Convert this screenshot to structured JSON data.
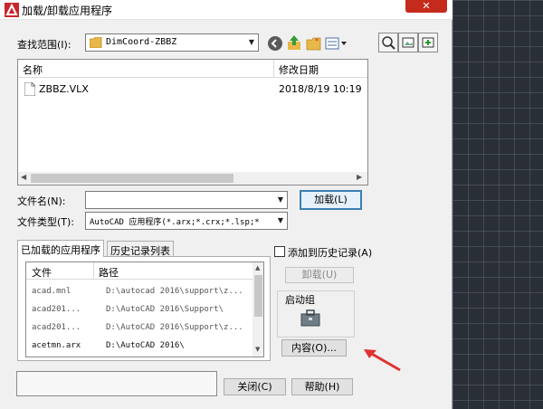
{
  "window": {
    "title": "加载/卸载应用程序",
    "close_label": "✕"
  },
  "lookin": {
    "label": "查找范围(I):",
    "value": "DimCoord-ZBBZ"
  },
  "filelist": {
    "columns": [
      "名称",
      "修改日期"
    ],
    "rows": [
      {
        "name": "ZBBZ.VLX",
        "date": "2018/8/19 10:19"
      }
    ]
  },
  "filename": {
    "label": "文件名(N):",
    "value": ""
  },
  "filetype": {
    "label": "文件类型(T):",
    "value": "AutoCAD 应用程序(*.arx;*.crx;*.lsp;*"
  },
  "buttons": {
    "load": "加载(L)",
    "unload": "卸载(U)",
    "contents": "内容(O)...",
    "close": "关闭(C)",
    "help": "帮助(H)"
  },
  "add_history": {
    "label": "添加到历史记录(A)",
    "checked": false
  },
  "tabs": [
    "已加载的应用程序",
    "历史记录列表"
  ],
  "loaded": {
    "columns": [
      "文件",
      "路径"
    ],
    "rows": [
      {
        "file": "acad.mnl",
        "path": "D:\\autocad 2016\\support\\z..."
      },
      {
        "file": "acad201...",
        "path": "D:\\AutoCAD 2016\\Support\\"
      },
      {
        "file": "acad201...",
        "path": "D:\\AutoCAD 2016\\Support\\z..."
      },
      {
        "file": "acetmn.arx",
        "path": "D:\\AutoCAD 2016\\"
      }
    ]
  },
  "startup": {
    "label": "启动组"
  },
  "colors": {
    "accent": "#3c7fb1",
    "close": "#c42b1c",
    "arrow": "#e0332f"
  }
}
